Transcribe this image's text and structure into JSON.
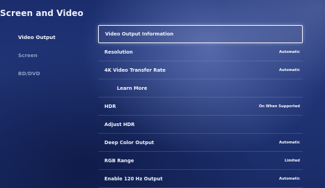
{
  "header": {
    "title": "Screen and Video"
  },
  "sidebar": {
    "items": [
      {
        "label": "Video Output"
      },
      {
        "label": "Screen"
      },
      {
        "label": "BD/DVD"
      }
    ]
  },
  "menu": {
    "rows": [
      {
        "label": "Video Output Information",
        "value": ""
      },
      {
        "label": "Resolution",
        "value": "Automatic"
      },
      {
        "label": "4K Video Transfer Rate",
        "value": "Automatic"
      },
      {
        "label": "Learn More",
        "value": ""
      },
      {
        "label": "HDR",
        "value": "On When Supported"
      },
      {
        "label": "Adjust HDR",
        "value": ""
      },
      {
        "label": "Deep Color Output",
        "value": "Automatic"
      },
      {
        "label": "RGB Range",
        "value": "Limited"
      },
      {
        "label": "Enable 120 Hz Output",
        "value": "Automatic"
      }
    ]
  }
}
